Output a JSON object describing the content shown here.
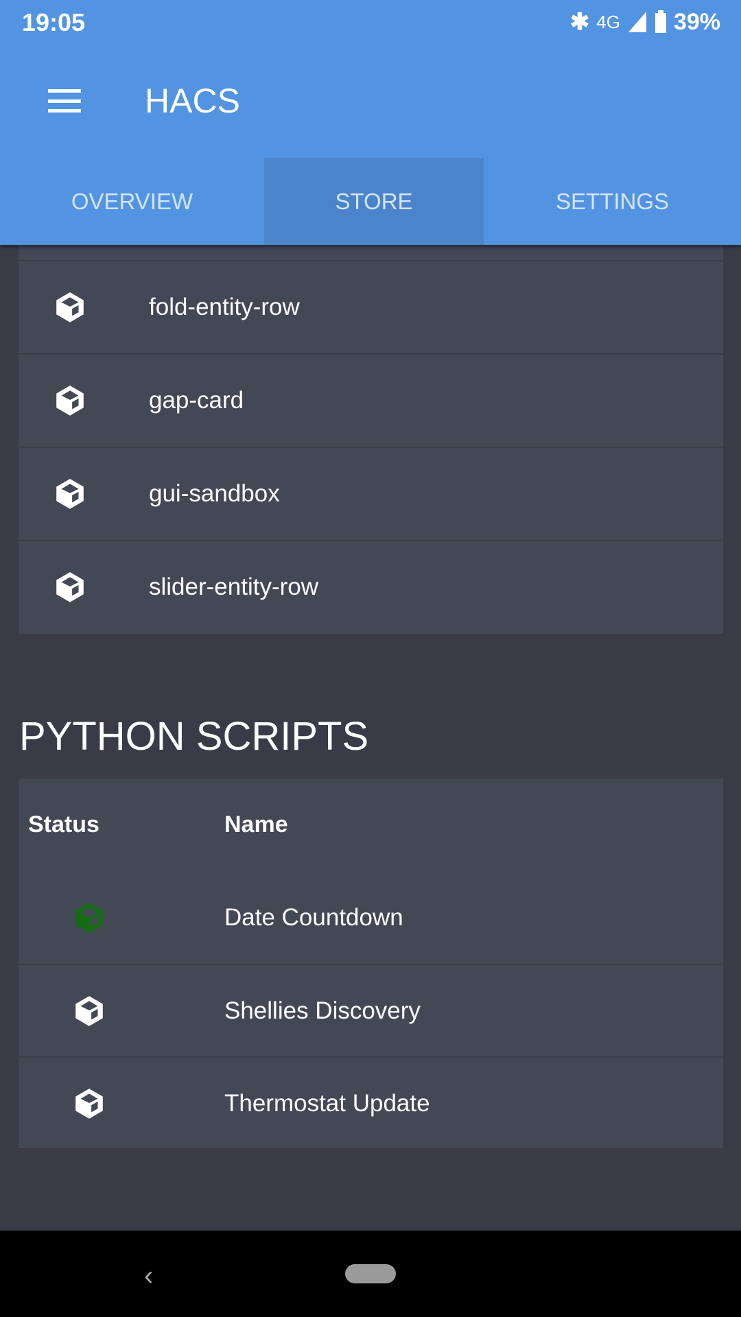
{
  "status_bar": {
    "time": "19:05",
    "network": "4G",
    "battery": "39%"
  },
  "app_bar": {
    "title": "HACS"
  },
  "tabs": [
    {
      "label": "OVERVIEW"
    },
    {
      "label": "STORE",
      "selected": true
    },
    {
      "label": "SETTINGS"
    }
  ],
  "plugins": [
    {
      "name": "fold-entity-row"
    },
    {
      "name": "gap-card"
    },
    {
      "name": "gui-sandbox"
    },
    {
      "name": "slider-entity-row"
    }
  ],
  "python_scripts": {
    "heading": "PYTHON SCRIPTS",
    "columns": [
      "Status",
      "Name"
    ],
    "rows": [
      {
        "name": "Date Countdown",
        "status_icon": "cube-icon",
        "status_color": "#146b14"
      },
      {
        "name": "Shellies Discovery",
        "status_icon": "cube-icon",
        "status_color": "#ffffff"
      },
      {
        "name": "Thermostat Update",
        "status_icon": "cube-icon",
        "status_color": "#ffffff"
      }
    ]
  },
  "colors": {
    "accent": "#5294e2",
    "background": "#393c46",
    "card": "#434855"
  }
}
